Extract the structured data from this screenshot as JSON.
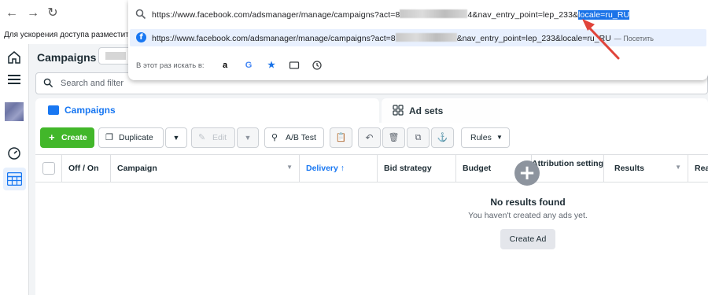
{
  "browser": {
    "back_icon": "arrow-left-icon",
    "forward_icon": "arrow-right-icon",
    "reload_icon": "reload-icon",
    "bookmarks_hint": "Для ускорения доступа разместите сво"
  },
  "omnibox": {
    "url_prefix": "https://www.facebook.com/adsmanager/manage/campaigns?act=",
    "url_mid_1": "8",
    "url_after_blur": "4&nav_entry_point=lep_233&",
    "url_selected": "locale=ru_RU",
    "suggestion_prefix": "https://www.facebook.com/adsmanager/manage/campaigns?act=",
    "suggestion_mid": "8",
    "suggestion_after": "&nav_entry_point=lep_233&locale=ru_RU",
    "suggestion_action": "— Посетить",
    "search_in_label": "В этот раз искать в:",
    "engines": [
      "amazon-icon",
      "google-icon",
      "star-icon",
      "tab-icon",
      "history-icon"
    ]
  },
  "ads_manager": {
    "page_title": "Campaigns",
    "search_placeholder": "Search and filter",
    "tabs": [
      {
        "label": "Campaigns"
      },
      {
        "label": "Ad sets"
      }
    ],
    "toolbar": {
      "create": "Create",
      "duplicate": "Duplicate",
      "edit": "Edit",
      "ab_test": "A/B Test",
      "rules": "Rules"
    },
    "columns": [
      "Off / On",
      "Campaign",
      "Delivery",
      "Bid strategy",
      "Budget",
      "Attribution setting",
      "Results",
      "Rea"
    ],
    "delivery_sort": "↑",
    "empty_state": {
      "title": "No results found",
      "subtitle": "You haven't created any ads yet.",
      "button": "Create Ad"
    }
  },
  "colors": {
    "accent": "#1877f2",
    "create_green": "#42b72a",
    "selection": "#1a73e8",
    "annotation_red": "#e0443a"
  }
}
